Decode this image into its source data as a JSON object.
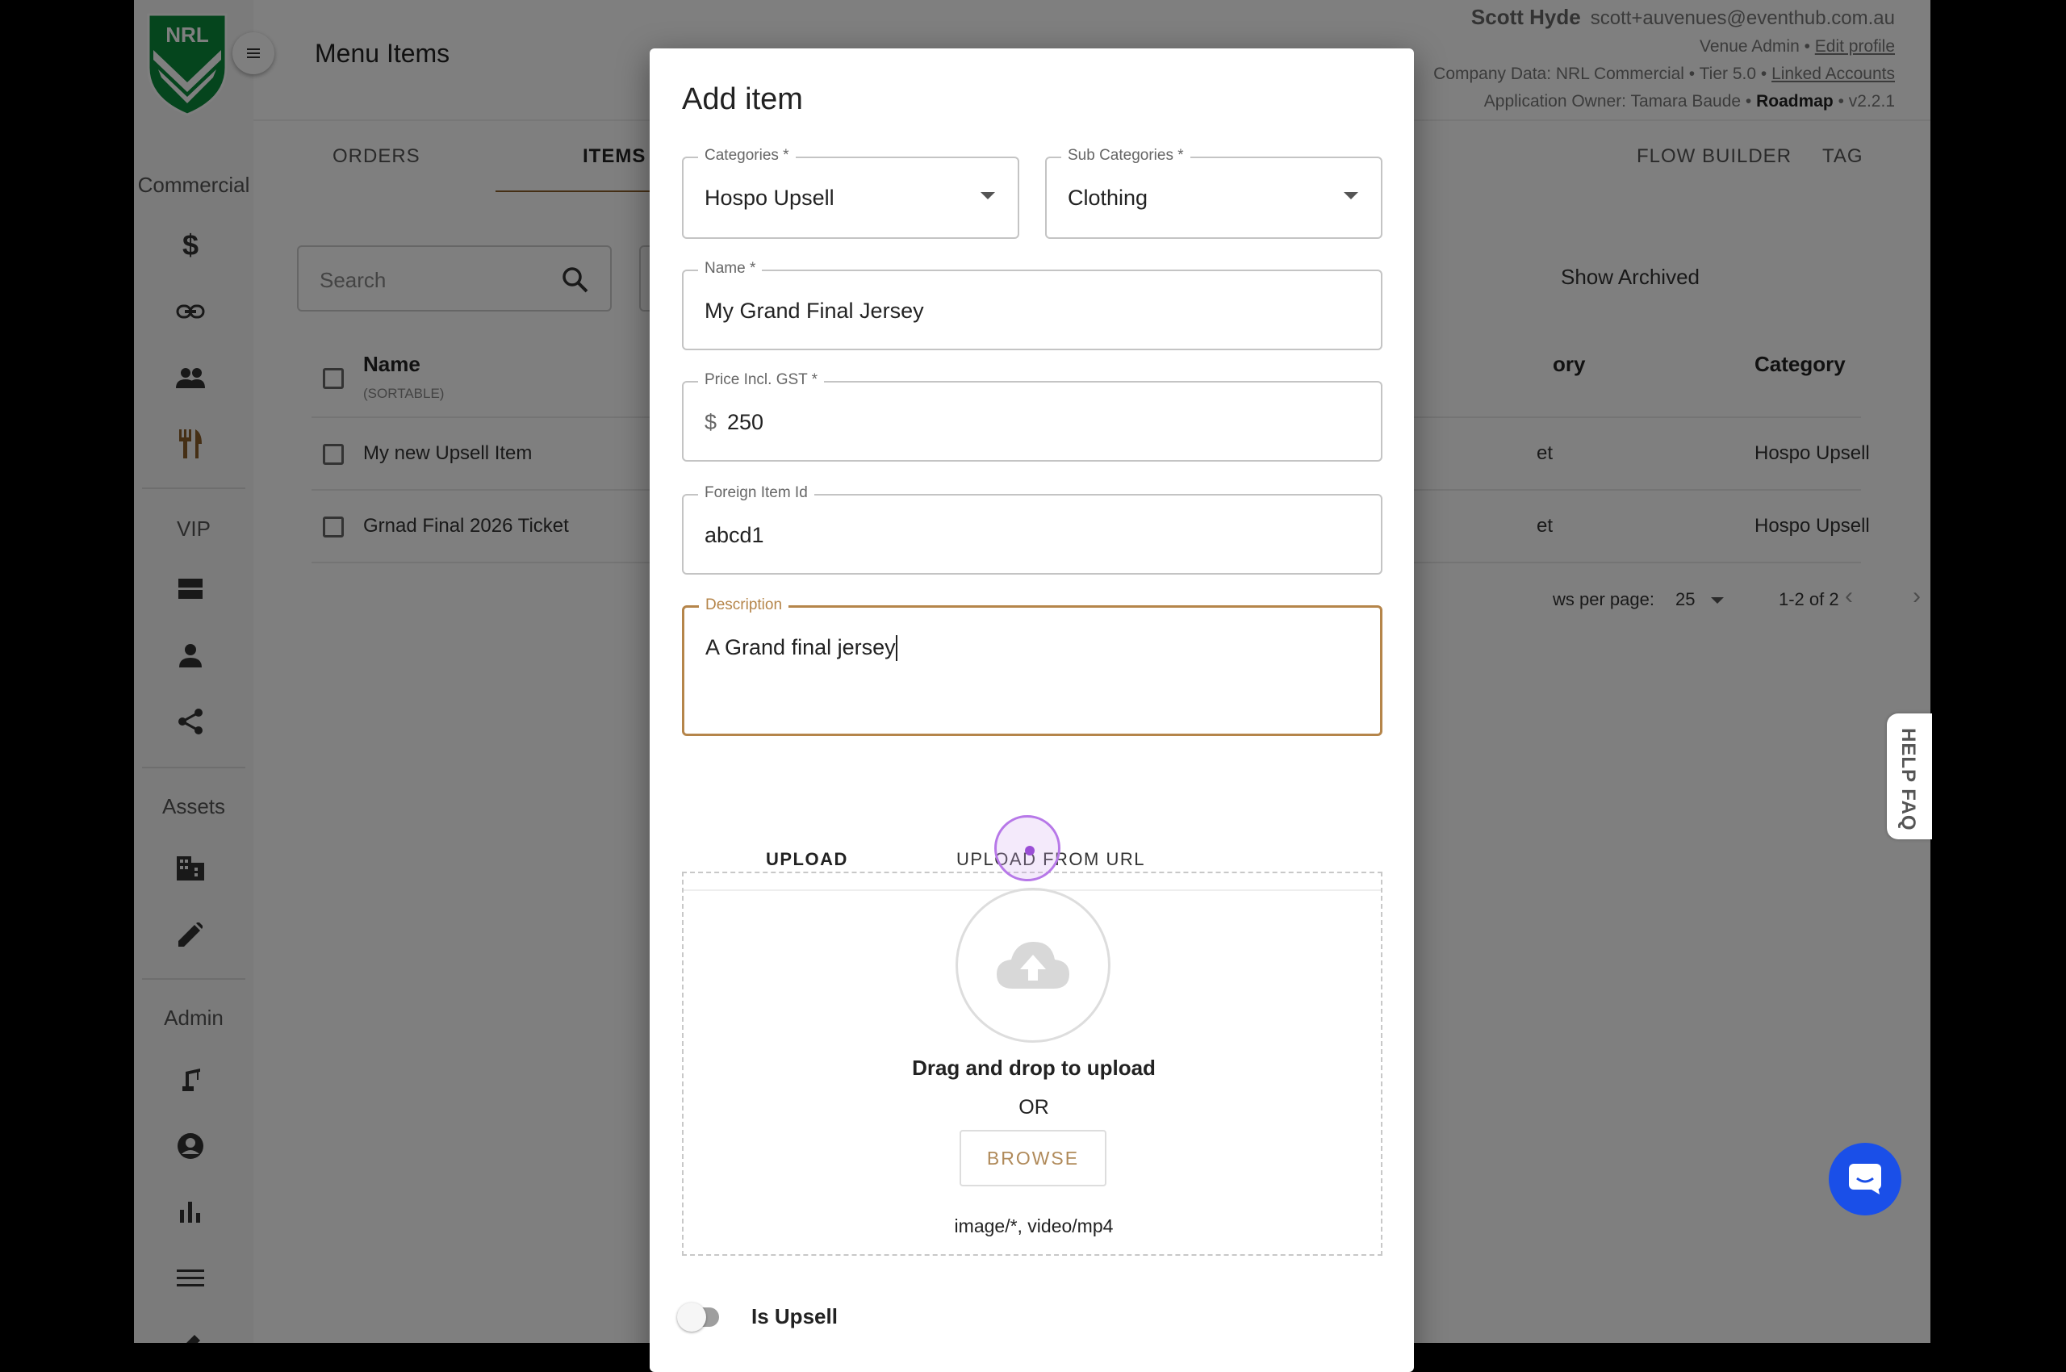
{
  "sidebar": {
    "sections": [
      "Commercial",
      "VIP",
      "Assets",
      "Admin"
    ],
    "icons": [
      "dollar-icon",
      "link-icon",
      "people-icon",
      "restaurant-icon",
      "table-icon",
      "person-icon",
      "share-icon",
      "building-icon",
      "edit-icon",
      "crane-icon",
      "account-icon",
      "bar-chart-icon",
      "menu-lines-icon",
      "pencil-icon"
    ]
  },
  "header": {
    "title": "Menu Items",
    "user_name": "Scott Hyde",
    "user_email": "scott+auvenues@eventhub.com.au",
    "role_line": "Venue Admin • ",
    "edit_profile": "Edit profile",
    "company_line": "Company Data: NRL Commercial • Tier 5.0 • ",
    "linked_accounts": "Linked Accounts",
    "owner_line": "Application Owner: Tamara Baude • ",
    "roadmap": "Roadmap",
    "version": " • v2.2.1"
  },
  "tabs": {
    "orders": "ORDERS",
    "items": "ITEMS",
    "flow_builder": "FLOW BUILDER",
    "tags": "TAG"
  },
  "list": {
    "search_placeholder": "Search",
    "show_archived": "Show Archived",
    "col_name": "Name",
    "col_name_sub": "(SORTABLE)",
    "col_subcat": "ory",
    "col_category": "Category",
    "rows": [
      {
        "name": "My new Upsell Item",
        "subcat": "et",
        "category": "Hospo Upsell"
      },
      {
        "name": "Grnad Final 2026 Ticket",
        "subcat": "et",
        "category": "Hospo Upsell"
      }
    ],
    "rows_per_page_label": "ws per page:",
    "rows_per_page": "25",
    "range": "1-2 of 2"
  },
  "help_faq": "HELP FAQ",
  "modal": {
    "title": "Add item",
    "categories_label": "Categories *",
    "categories_value": "Hospo Upsell",
    "subcategories_label": "Sub Categories *",
    "subcategories_value": "Clothing",
    "name_label": "Name *",
    "name_value": "My Grand Final Jersey",
    "price_label": "Price Incl. GST *",
    "price_currency": "$",
    "price_value": "250",
    "foreign_label": "Foreign Item Id",
    "foreign_value": "abcd1",
    "description_label": "Description",
    "description_value": "A Grand final jersey",
    "upload_tab": "UPLOAD",
    "upload_url_tab": "UPLOAD FROM URL",
    "dz_title": "Drag and drop to upload",
    "dz_or": "OR",
    "browse": "BROWSE",
    "accepted": "image/*, video/mp4",
    "is_upsell": "Is Upsell"
  },
  "colors": {
    "brand_brown": "#8b5e2a",
    "focus_gold": "#b5854a",
    "chat_blue": "#1a4fe8",
    "nrl_green": "#0a8a3a"
  }
}
